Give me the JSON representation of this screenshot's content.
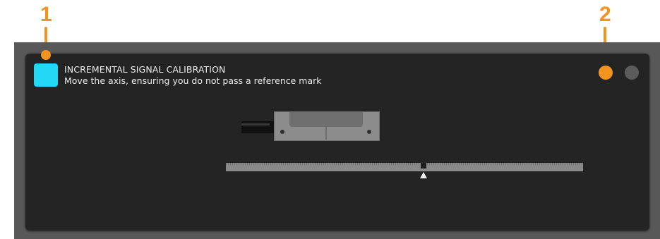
{
  "callouts": [
    {
      "number": "1"
    },
    {
      "number": "2"
    }
  ],
  "header": {
    "title": "INCREMENTAL SIGNAL CALIBRATION",
    "subtitle": "Move the axis, ensuring you do not pass a reference mark"
  },
  "status": {
    "square_color": "#23d8f5",
    "led_active_color": "#f39320",
    "led_inactive_color": "#5c5c5c"
  },
  "accent_color": "#f39320"
}
